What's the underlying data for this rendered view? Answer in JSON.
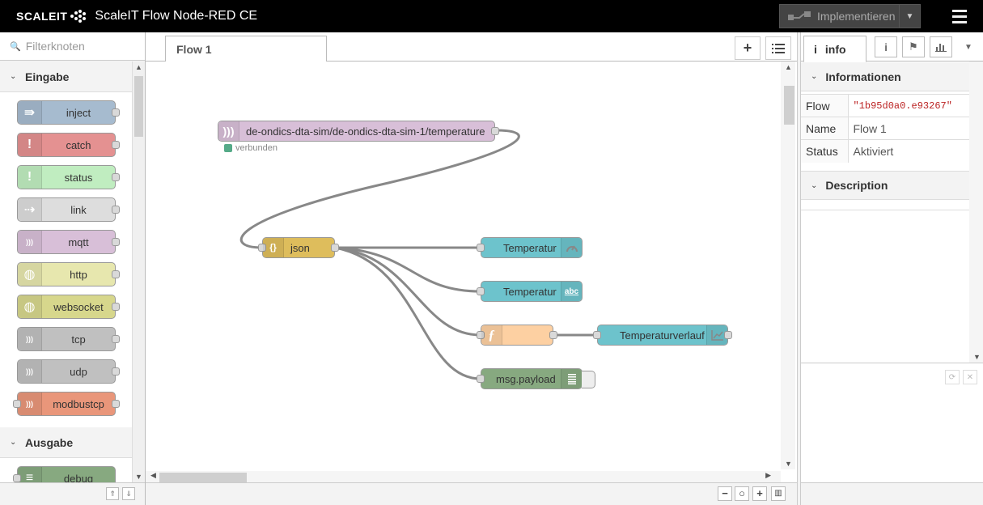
{
  "header": {
    "brand": "SCALEIT",
    "title": "ScaleIT Flow Node-RED CE",
    "deploy_label": "Implementieren"
  },
  "palette": {
    "search_placeholder": "Filterknoten",
    "categories": [
      {
        "label": "Eingabe",
        "nodes": [
          {
            "label": "inject",
            "color": "#a6bbcf",
            "icon": "arrow-in-icon"
          },
          {
            "label": "catch",
            "color": "#e49191",
            "icon": "exclamation-icon"
          },
          {
            "label": "status",
            "color": "#c0edc0",
            "icon": "exclamation-icon"
          },
          {
            "label": "link",
            "color": "#dddddd",
            "icon": "link-in-icon"
          },
          {
            "label": "mqtt",
            "color": "#d8bfd8",
            "icon": "bridge-icon"
          },
          {
            "label": "http",
            "color": "#e7e7ae",
            "icon": "globe-icon"
          },
          {
            "label": "websocket",
            "color": "#d7d78c",
            "icon": "globe-icon"
          },
          {
            "label": "tcp",
            "color": "#c0c0c0",
            "icon": "bridge-icon"
          },
          {
            "label": "udp",
            "color": "#c0c0c0",
            "icon": "bridge-icon"
          },
          {
            "label": "modbustcp",
            "color": "#e9967a",
            "icon": "bridge-icon"
          }
        ]
      },
      {
        "label": "Ausgabe",
        "nodes": [
          {
            "label": "debug",
            "color": "#87a980",
            "icon": "list-icon"
          }
        ]
      }
    ]
  },
  "workspace": {
    "tab_label": "Flow 1",
    "nodes": {
      "mqtt_in": {
        "label": "de-ondics-dta-sim/de-ondics-dta-sim-1/temperature",
        "color": "#d8bfd8",
        "status": "verbunden",
        "status_color": "#55aa88"
      },
      "json": {
        "label": "json",
        "color": "#debd5c"
      },
      "gauge": {
        "label": "Temperatur",
        "color": "#6dc3cc"
      },
      "text": {
        "label": "Temperatur",
        "color": "#6dc3cc",
        "icon_text": "abc"
      },
      "function": {
        "label": "",
        "color": "#fdd0a2"
      },
      "chart": {
        "label": "Temperaturverlauf",
        "color": "#6dc3cc"
      },
      "debug": {
        "label": "msg.payload",
        "color": "#87a980"
      }
    },
    "wire_color": "#888888"
  },
  "sidebar": {
    "tab_label": "info",
    "info_section": "Informationen",
    "rows": [
      {
        "key": "Flow",
        "value": "\"1b95d0a0.e93267\""
      },
      {
        "key": "Name",
        "value": "Flow 1"
      },
      {
        "key": "Status",
        "value": "Aktiviert"
      }
    ],
    "description_section": "Description"
  }
}
